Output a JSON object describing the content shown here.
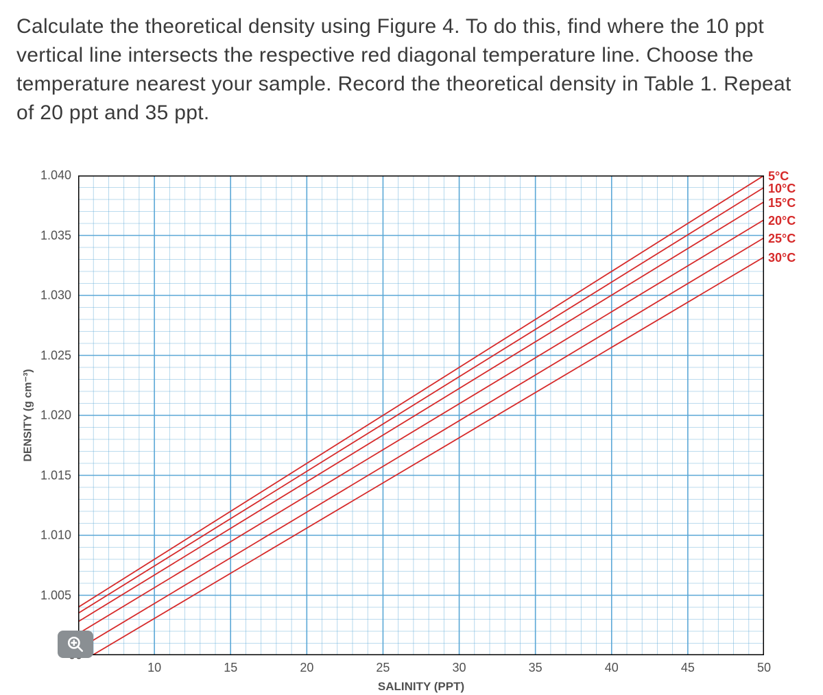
{
  "prompt_text": "Calculate the theoretical density using Figure 4. To do this, find where the 10 ppt vertical line intersects the respective red diagonal temperature line. Choose the temperature nearest your sample. Record the theoretical density in Table 1. Repeat of 20 ppt and 35 ppt.",
  "chart_data": {
    "type": "line",
    "title": "",
    "xlabel": "SALINITY (PPT)",
    "ylabel": "DENSITY (g cm⁻³)",
    "xlim": [
      5,
      50
    ],
    "ylim": [
      1.0,
      1.04
    ],
    "x_ticks": [
      10,
      15,
      20,
      25,
      30,
      35,
      40,
      45,
      50
    ],
    "y_ticks": [
      1.04,
      1.035,
      1.03,
      1.025,
      1.02,
      1.015,
      1.01,
      1.005
    ],
    "y_tick_labels": [
      "1.040",
      "1.035",
      "1.030",
      "1.025",
      "1.020",
      "1.015",
      "1.010",
      "1.005"
    ],
    "series": [
      {
        "name": "5°C",
        "color": "#d62a2a",
        "x": [
          5,
          50
        ],
        "y": [
          1.004,
          1.04
        ]
      },
      {
        "name": "10°C",
        "color": "#d62a2a",
        "x": [
          5,
          50
        ],
        "y": [
          1.0035,
          1.039
        ]
      },
      {
        "name": "15°C",
        "color": "#d62a2a",
        "x": [
          5,
          50
        ],
        "y": [
          1.0028,
          1.0378
        ]
      },
      {
        "name": "20°C",
        "color": "#d62a2a",
        "x": [
          5,
          50
        ],
        "y": [
          1.0018,
          1.0363
        ]
      },
      {
        "name": "25°C",
        "color": "#d62a2a",
        "x": [
          5,
          50
        ],
        "y": [
          1.0005,
          1.0348
        ]
      },
      {
        "name": "30°C",
        "color": "#d62a2a",
        "x": [
          5,
          50
        ],
        "y": [
          0.9993,
          1.0332
        ]
      }
    ],
    "legend": [
      "5°C",
      "10°C",
      "15°C",
      "20°C",
      "25°C",
      "30°C"
    ],
    "grid": {
      "major_x_step": 5,
      "minor_x_step": 1,
      "major_y_step": 0.005,
      "minor_y_step": 0.001,
      "color": "#5aa7d6"
    }
  }
}
